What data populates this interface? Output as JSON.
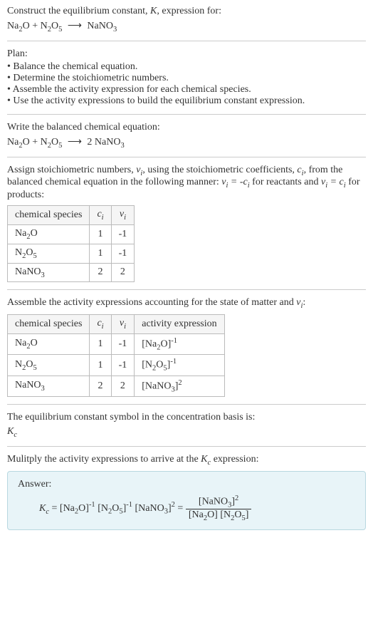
{
  "header": {
    "line1_prefix": "Construct the equilibrium constant, ",
    "line1_K": "K",
    "line1_suffix": ", expression for:"
  },
  "plan": {
    "title": "Plan:",
    "items": [
      "Balance the chemical equation.",
      "Determine the stoichiometric numbers.",
      "Assemble the activity expression for each chemical species.",
      "Use the activity expressions to build the equilibrium constant expression."
    ]
  },
  "balanced": {
    "title": "Write the balanced chemical equation:"
  },
  "stoich": {
    "intro_part1": "Assign stoichiometric numbers, ",
    "intro_part2": ", using the stoichiometric coefficients, ",
    "intro_part3": ", from the balanced chemical equation in the following manner: ",
    "intro_part4": " for reactants and ",
    "intro_part5": " for products:",
    "headers": {
      "species": "chemical species",
      "ci": "c",
      "vi": "ν"
    },
    "rows": [
      {
        "ci": "1",
        "vi": "-1"
      },
      {
        "ci": "1",
        "vi": "-1"
      },
      {
        "ci": "2",
        "vi": "2"
      }
    ]
  },
  "activity": {
    "intro_part1": "Assemble the activity expressions accounting for the state of matter and ",
    "intro_part2": ":",
    "headers": {
      "species": "chemical species",
      "ci": "c",
      "vi": "ν",
      "activity": "activity expression"
    },
    "rows": [
      {
        "ci": "1",
        "vi": "-1"
      },
      {
        "ci": "1",
        "vi": "-1"
      },
      {
        "ci": "2",
        "vi": "2"
      }
    ]
  },
  "constant": {
    "line1": "The equilibrium constant symbol in the concentration basis is:"
  },
  "multiply": {
    "intro_part1": "Mulitply the activity expressions to arrive at the ",
    "intro_part2": " expression:"
  },
  "answer": {
    "label": "Answer:"
  },
  "chart_data": {
    "type": "table",
    "reaction_unbalanced": "Na2O + N2O5 ⟶ NaNO3",
    "reaction_balanced": "Na2O + N2O5 ⟶ 2 NaNO3",
    "stoichiometric_table": {
      "columns": [
        "chemical species",
        "c_i",
        "ν_i"
      ],
      "rows": [
        [
          "Na2O",
          1,
          -1
        ],
        [
          "N2O5",
          1,
          -1
        ],
        [
          "NaNO3",
          2,
          2
        ]
      ]
    },
    "activity_table": {
      "columns": [
        "chemical species",
        "c_i",
        "ν_i",
        "activity expression"
      ],
      "rows": [
        [
          "Na2O",
          1,
          -1,
          "[Na2O]^-1"
        ],
        [
          "N2O5",
          1,
          -1,
          "[N2O5]^-1"
        ],
        [
          "NaNO3",
          2,
          2,
          "[NaNO3]^2"
        ]
      ]
    },
    "equilibrium_constant": "K_c = [Na2O]^-1 [N2O5]^-1 [NaNO3]^2 = [NaNO3]^2 / ([Na2O][N2O5])"
  }
}
